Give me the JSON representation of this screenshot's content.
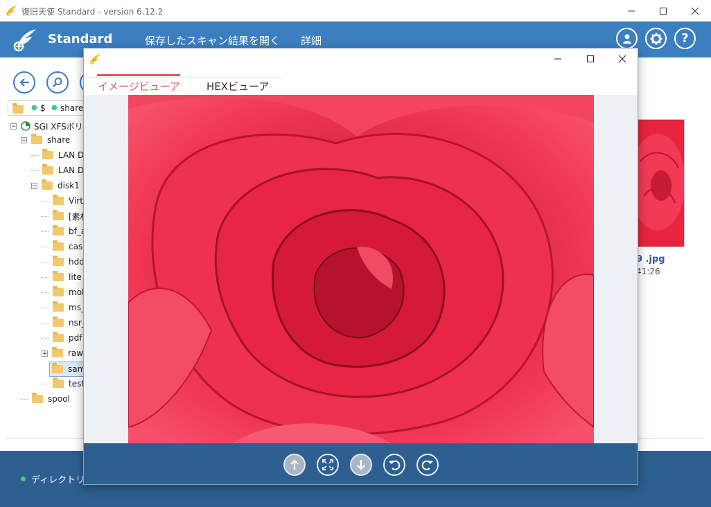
{
  "app": {
    "title": "復旧天使 Standard - version 6.12.2",
    "brand": "Standard",
    "menu_open_scan": "保存したスキャン結果を開く",
    "menu_detail": "詳細",
    "colors": {
      "header": "#3c7fc1",
      "footer": "#2e5f91",
      "accent_red": "#d95c5c"
    }
  },
  "pathbar": {
    "dollar": "$",
    "share": "share"
  },
  "tree": {
    "root": "SGI XFSボリ",
    "share": "share",
    "lan1": "LAN DI",
    "lan2": "LAN DI",
    "disk1": "disk1",
    "children": [
      "Virtu",
      "[素材",
      "bf_a",
      "case",
      "hdds",
      "lite",
      "mob",
      "ms_",
      "nsr_",
      "pdf",
      "raw",
      "sam",
      "test_"
    ],
    "spool": "spool"
  },
  "side_panel": {
    "file_name": "9 .jpg",
    "time": "41:26"
  },
  "footer": {
    "status": "ディレクトリ"
  },
  "viewer": {
    "tabs": [
      "イメージビューア",
      "HEXビューア"
    ],
    "active_tab": 0,
    "nav_icons": [
      "arrow-up-icon",
      "fit-screen-icon",
      "arrow-down-icon",
      "rotate-left-icon",
      "rotate-right-icon"
    ]
  }
}
